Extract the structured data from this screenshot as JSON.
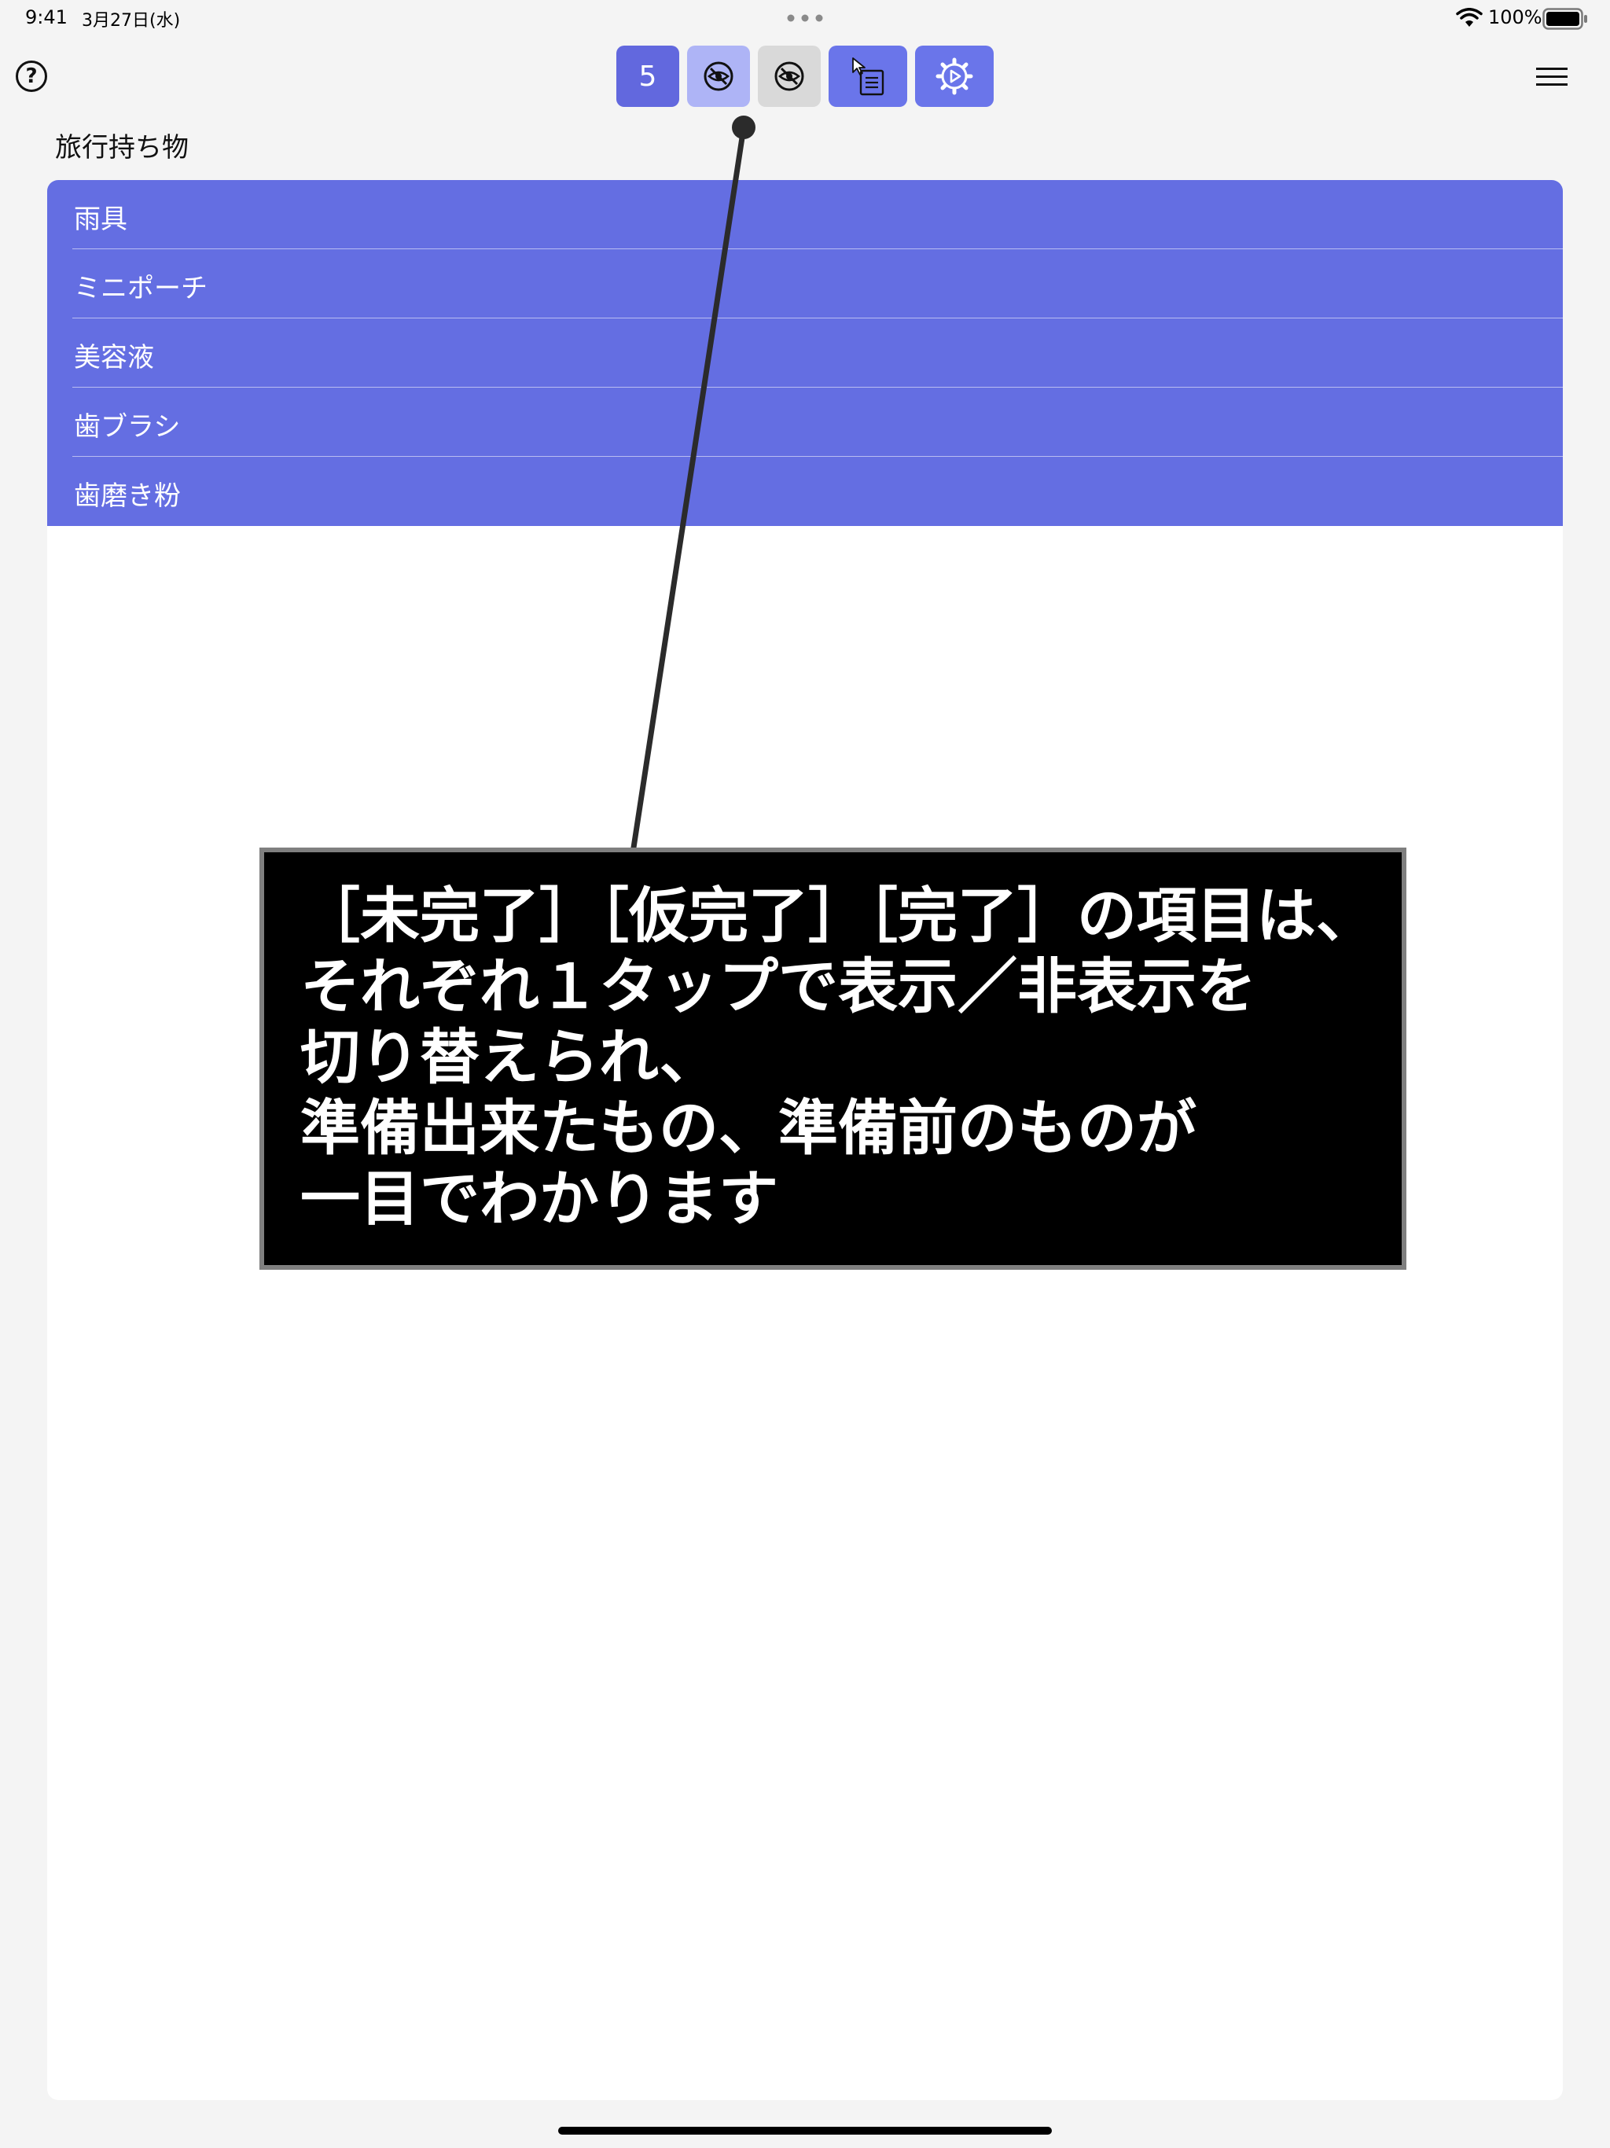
{
  "status_bar": {
    "time": "9:41",
    "date": "3月27日(水)",
    "battery_percent": "100%"
  },
  "toolbar": {
    "help_label": "?",
    "count_label": "5",
    "icons": {
      "hide_provisional": "eye-slash-icon",
      "hide_done": "eye-slash-icon",
      "list_select": "list-pointer-icon",
      "settings": "gear-play-icon",
      "menu": "hamburger-icon"
    }
  },
  "list": {
    "title": "旅行持ち物",
    "items": [
      {
        "label": "雨具"
      },
      {
        "label": "ミニポーチ"
      },
      {
        "label": "美容液"
      },
      {
        "label": "歯ブラシ"
      },
      {
        "label": "歯磨き粉"
      }
    ]
  },
  "callout": {
    "lines": [
      "［未完了］［仮完了］［完了］の項目は、",
      "それぞれ１タップで表示／非表示を",
      "切り替えられ、",
      "準備出来たもの、準備前のものが",
      "一目でわかります"
    ]
  },
  "colors": {
    "accent": "#6268de",
    "list_row": "#646ee2",
    "provisional_button": "#aeb4f6",
    "done_button": "#d9d9d9"
  }
}
